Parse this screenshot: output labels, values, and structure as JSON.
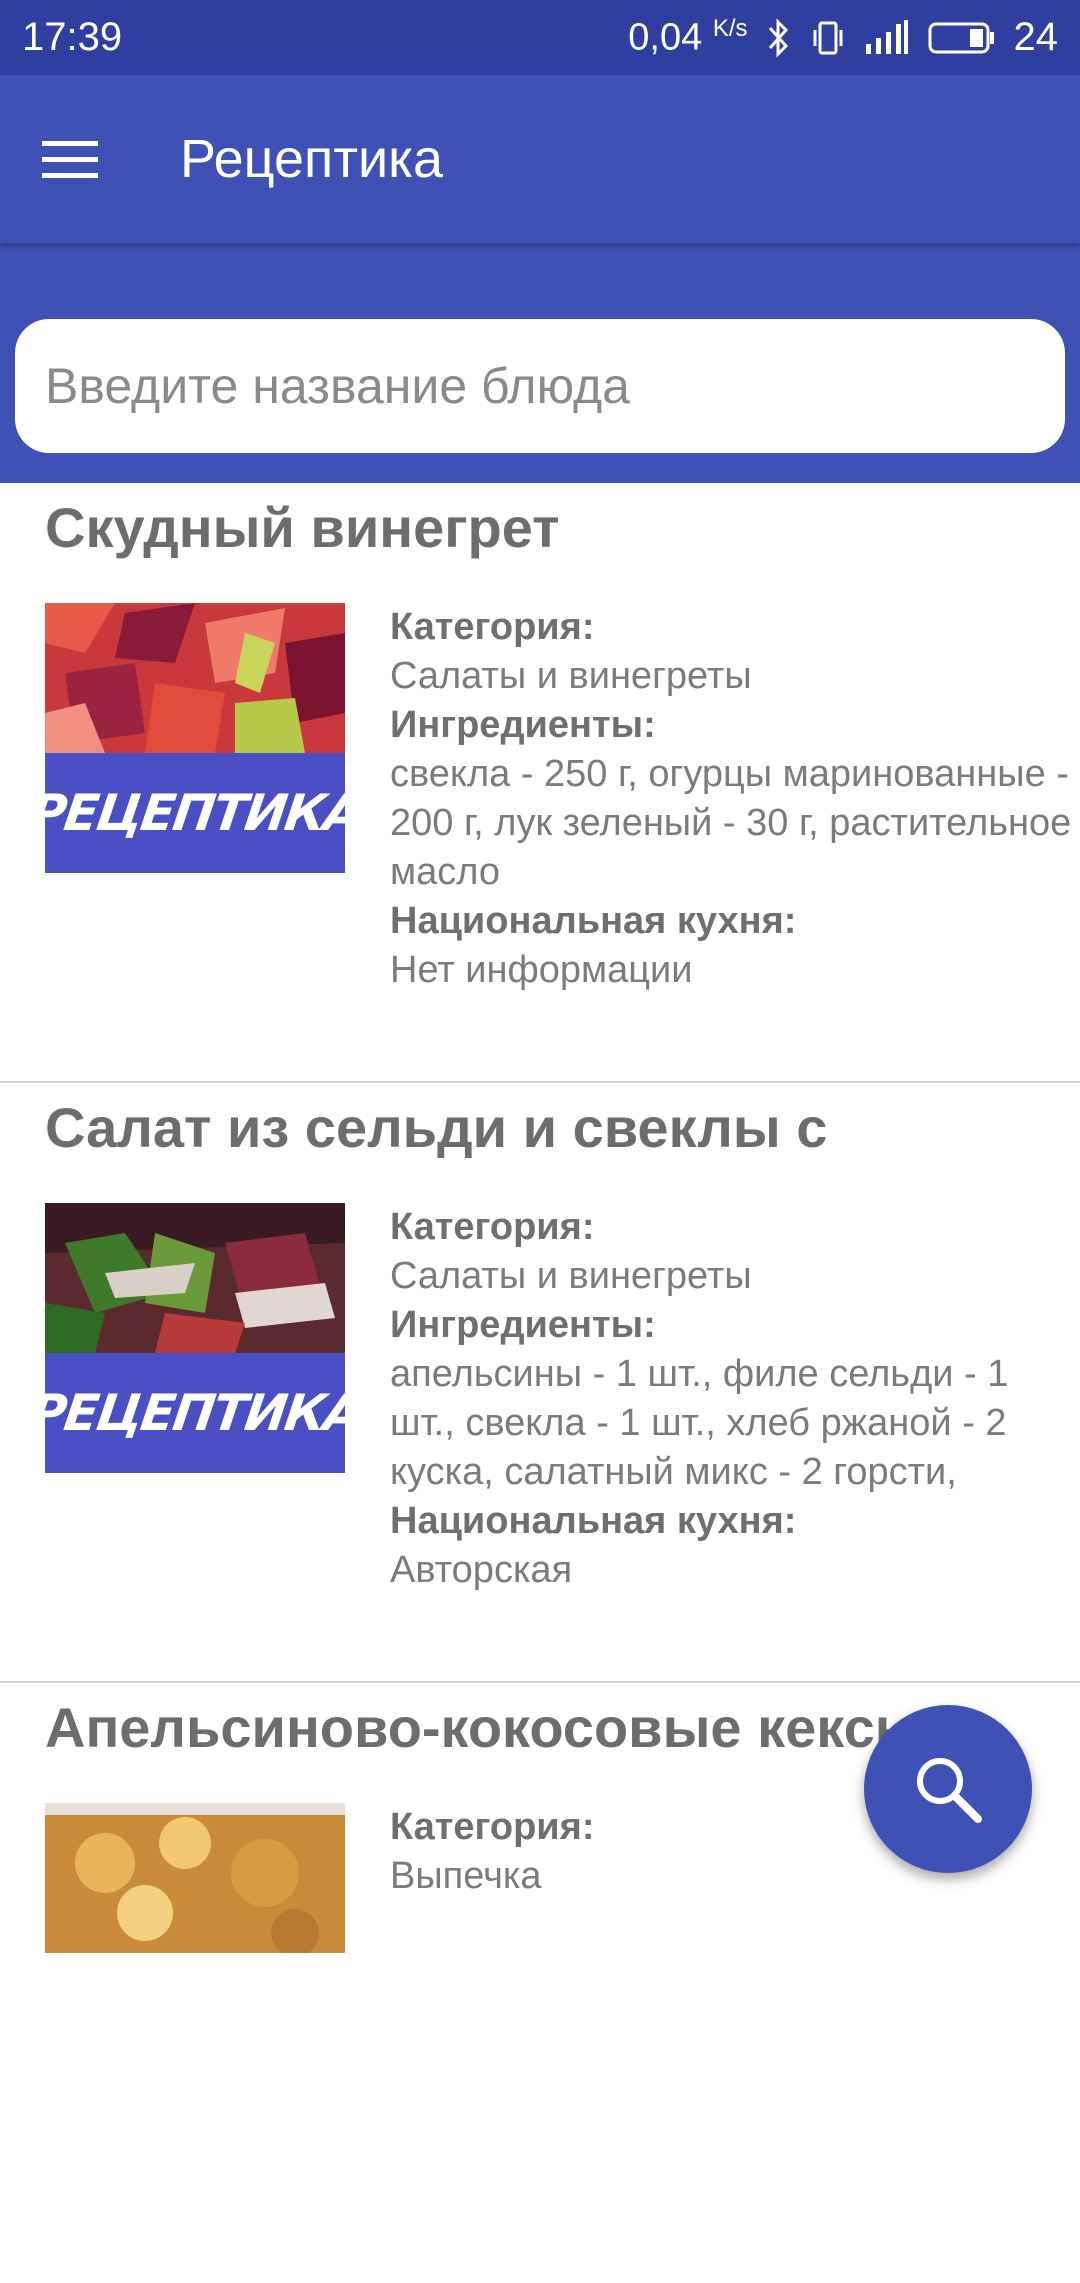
{
  "status_bar": {
    "time": "17:39",
    "net_speed": "0,04",
    "net_unit": "K/s",
    "battery": "24",
    "icons": [
      "bluetooth-icon",
      "vibrate-icon",
      "signal-icon",
      "battery-icon"
    ]
  },
  "app_bar": {
    "title": "Рецептика",
    "menu_icon": "menu-icon"
  },
  "search": {
    "placeholder": "Введите название блюда",
    "value": ""
  },
  "labels": {
    "category": "Категория:",
    "ingredients": "Ингредиенты:",
    "cuisine": "Национальная кухня:"
  },
  "brand_watermark": "РЕЦЕПТИКА",
  "recipes": [
    {
      "title": "Скудный винегрет",
      "category": "Салаты и винегреты",
      "ingredients": "свекла - 250 г, огурцы маринованные - 200 г, лук зеленый - 30 г, растительное масло",
      "cuisine": "Нет информации"
    },
    {
      "title": "Салат из сельди и свеклы с",
      "category": "Салаты и винегреты",
      "ingredients": "апельсины - 1 шт., филе сельди - 1 шт., свекла - 1 шт., хлеб ржаной - 2 куска, салатный микс - 2 горсти,",
      "cuisine": "Авторская"
    },
    {
      "title": "Апельсиново-кокосовые кексы",
      "category": "Выпечка"
    }
  ],
  "fab_icon": "search-icon",
  "colors": {
    "primary": "#3f51b5",
    "primary_dark": "#303f9f",
    "brand_overlay": "#4a4fc4"
  }
}
